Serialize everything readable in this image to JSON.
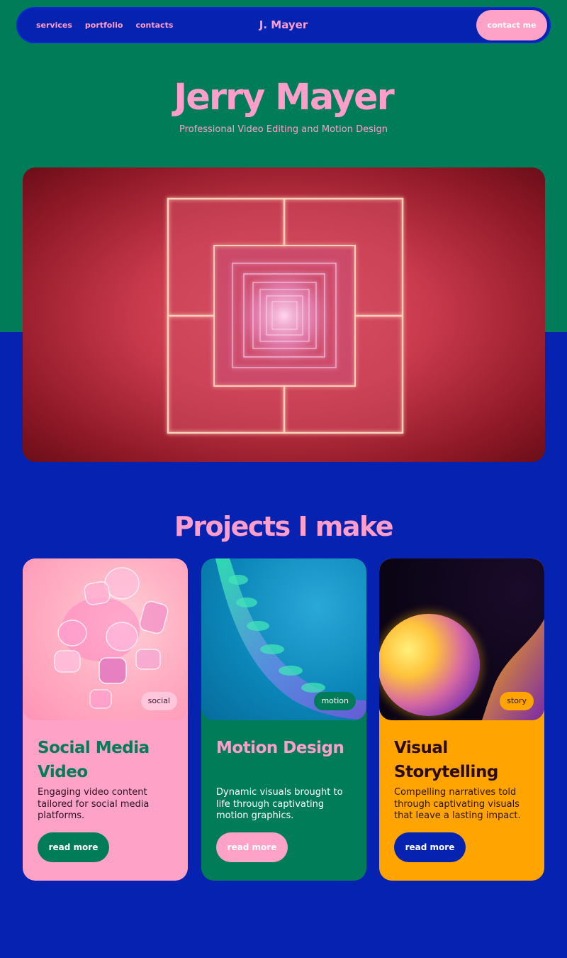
{
  "nav": {
    "links": [
      "services",
      "portfolio",
      "contacts"
    ],
    "brand": "J. Mayer",
    "contact_label": "contact me"
  },
  "hero": {
    "title": "Jerry Mayer",
    "subtitle": "Professional Video Editing and Motion Design"
  },
  "projects": {
    "title": "Projects I make",
    "cards": [
      {
        "tag": "social",
        "title": "Social Media Video",
        "description": "Engaging video content tailored for social media platforms.",
        "button": "read more"
      },
      {
        "tag": "motion",
        "title": "Motion Design",
        "description": "Dynamic visuals brought to life through captivating motion graphics.",
        "button": "read more"
      },
      {
        "tag": "story",
        "title": "Visual Storytelling",
        "description": "Compelling narratives told through captivating visuals that leave a lasting impact.",
        "button": "read more"
      }
    ]
  },
  "colors": {
    "green": "#007d58",
    "blue": "#0523b0",
    "pink": "#ff9ecb",
    "orange": "#ffa400"
  }
}
